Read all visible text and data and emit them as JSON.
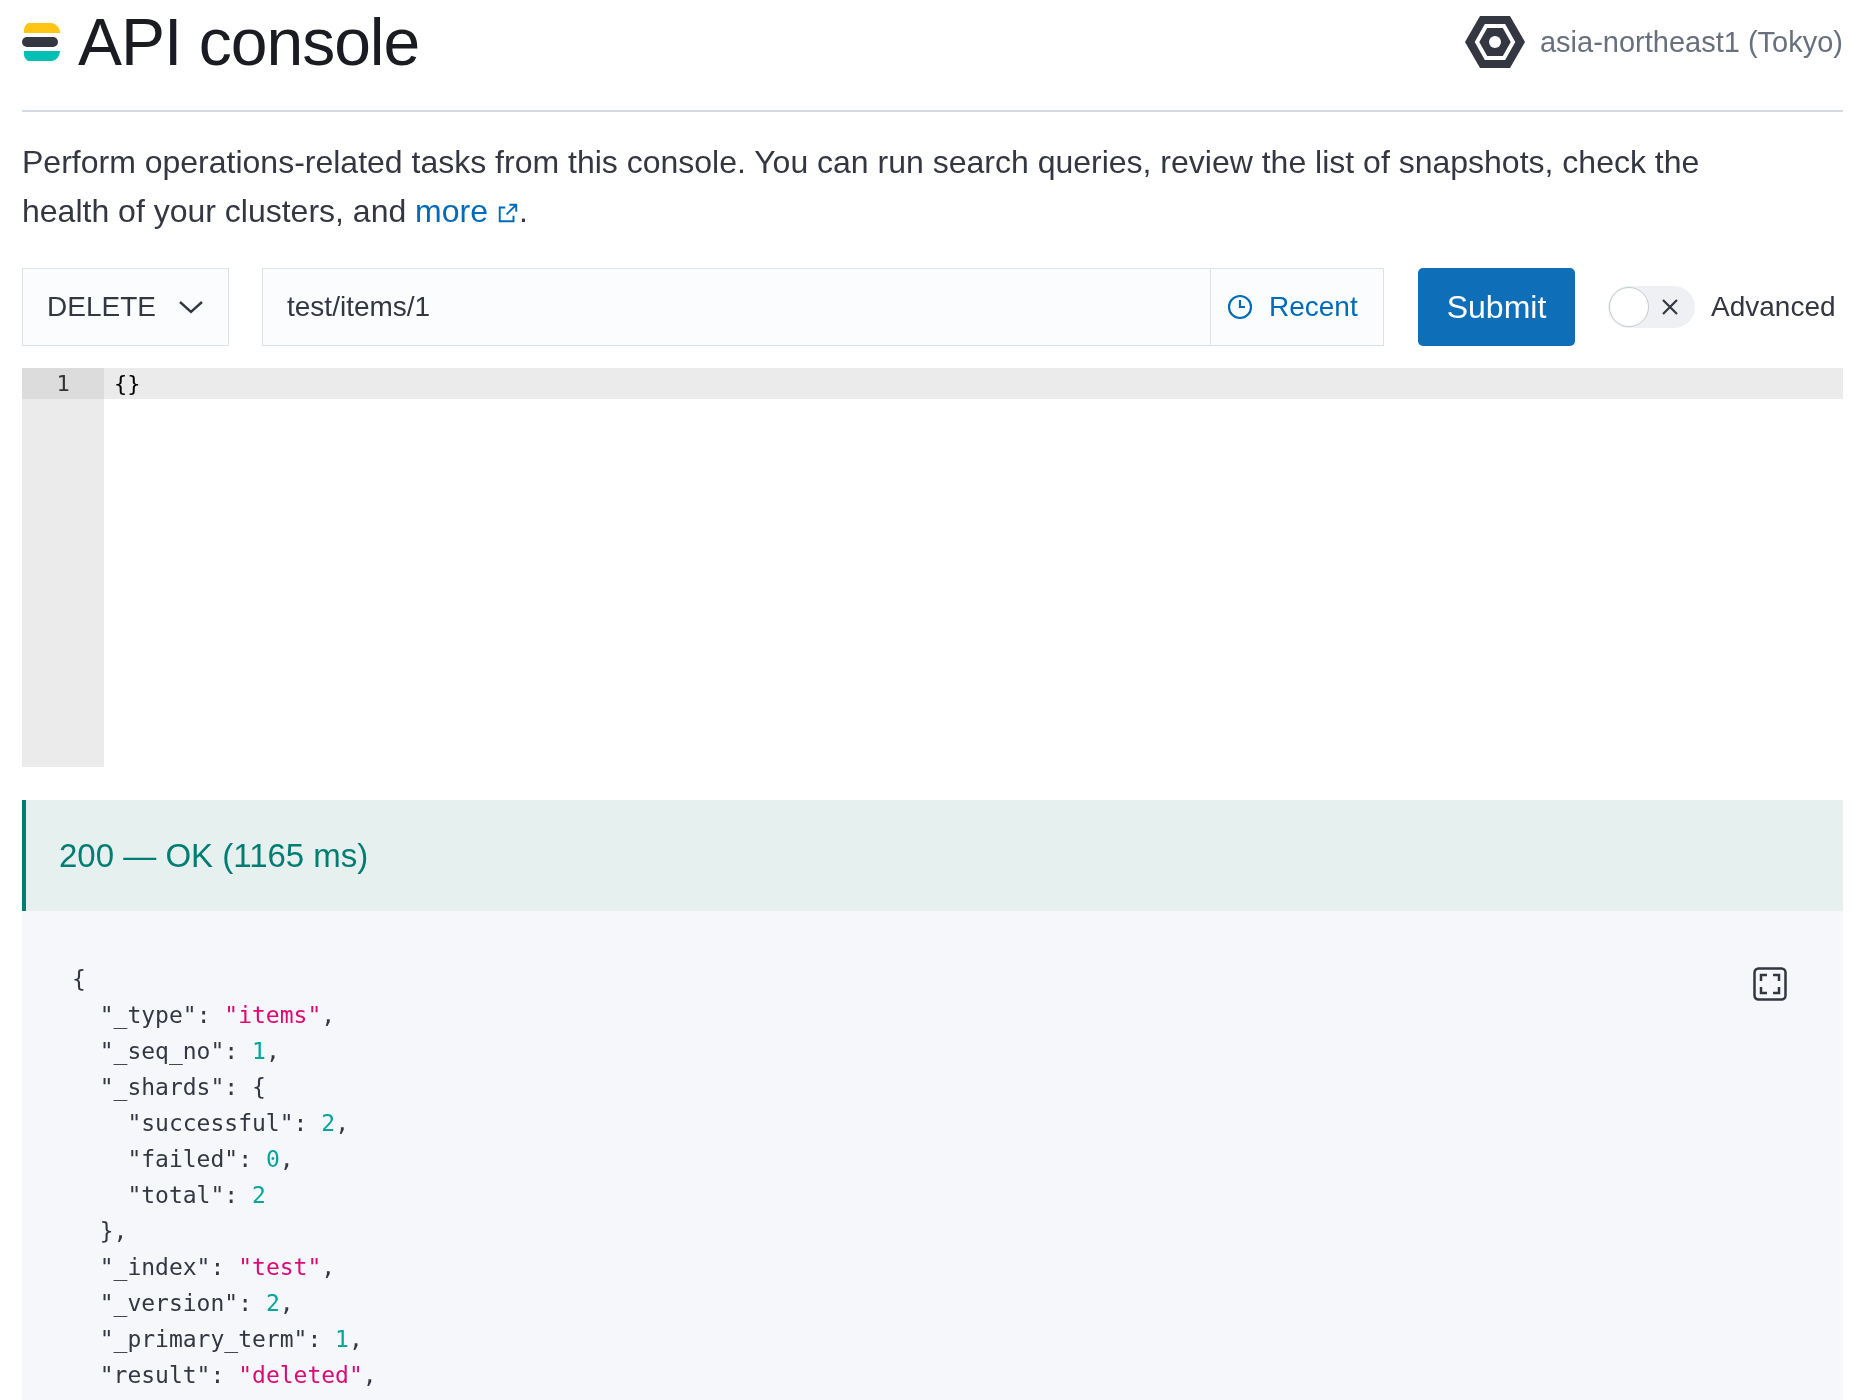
{
  "header": {
    "title": "API console",
    "region": "asia-northeast1 (Tokyo)"
  },
  "description": {
    "text": "Perform operations-related tasks from this console. You can run search queries, review the list of snapshots, check the health of your clusters, and ",
    "link": "more",
    "tail": "."
  },
  "request": {
    "method": "DELETE",
    "path": "test/items/1",
    "recent": "Recent",
    "submit": "Submit",
    "advanced": {
      "label": "Advanced",
      "on": false
    }
  },
  "editor": {
    "lines": [
      {
        "number": "1",
        "text": "{}",
        "active": true
      }
    ]
  },
  "response": {
    "status": "200 — OK (1165 ms)",
    "lines": [
      [
        {
          "kind": "punct",
          "text": "{"
        }
      ],
      [
        {
          "kind": "key",
          "text": "  \"_type\""
        },
        {
          "kind": "punct",
          "text": ": "
        },
        {
          "kind": "string",
          "text": "\"items\""
        },
        {
          "kind": "punct",
          "text": ","
        }
      ],
      [
        {
          "kind": "key",
          "text": "  \"_seq_no\""
        },
        {
          "kind": "punct",
          "text": ": "
        },
        {
          "kind": "number",
          "text": "1"
        },
        {
          "kind": "punct",
          "text": ","
        }
      ],
      [
        {
          "kind": "key",
          "text": "  \"_shards\""
        },
        {
          "kind": "punct",
          "text": ": {"
        }
      ],
      [
        {
          "kind": "key",
          "text": "    \"successful\""
        },
        {
          "kind": "punct",
          "text": ": "
        },
        {
          "kind": "number",
          "text": "2"
        },
        {
          "kind": "punct",
          "text": ","
        }
      ],
      [
        {
          "kind": "key",
          "text": "    \"failed\""
        },
        {
          "kind": "punct",
          "text": ": "
        },
        {
          "kind": "number",
          "text": "0"
        },
        {
          "kind": "punct",
          "text": ","
        }
      ],
      [
        {
          "kind": "key",
          "text": "    \"total\""
        },
        {
          "kind": "punct",
          "text": ": "
        },
        {
          "kind": "number",
          "text": "2"
        }
      ],
      [
        {
          "kind": "punct",
          "text": "  },"
        }
      ],
      [
        {
          "kind": "key",
          "text": "  \"_index\""
        },
        {
          "kind": "punct",
          "text": ": "
        },
        {
          "kind": "string",
          "text": "\"test\""
        },
        {
          "kind": "punct",
          "text": ","
        }
      ],
      [
        {
          "kind": "key",
          "text": "  \"_version\""
        },
        {
          "kind": "punct",
          "text": ": "
        },
        {
          "kind": "number",
          "text": "2"
        },
        {
          "kind": "punct",
          "text": ","
        }
      ],
      [
        {
          "kind": "key",
          "text": "  \"_primary_term\""
        },
        {
          "kind": "punct",
          "text": ": "
        },
        {
          "kind": "number",
          "text": "1"
        },
        {
          "kind": "punct",
          "text": ","
        }
      ],
      [
        {
          "kind": "key",
          "text": "  \"result\""
        },
        {
          "kind": "punct",
          "text": ": "
        },
        {
          "kind": "string",
          "text": "\"deleted\""
        },
        {
          "kind": "punct",
          "text": ","
        }
      ]
    ]
  }
}
